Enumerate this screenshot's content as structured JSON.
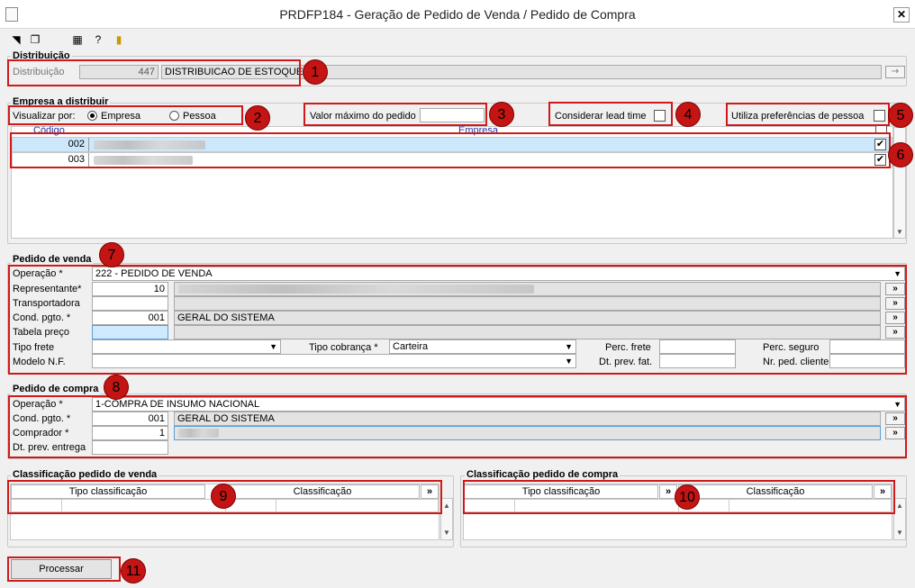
{
  "window": {
    "title": "PRDFP184 - Geração de Pedido de Venda / Pedido de Compra",
    "close": "✕"
  },
  "toolbar": {
    "icons": [
      "exit-icon",
      "copy-icon",
      "calculator-icon",
      "help-icon",
      "door-icon"
    ]
  },
  "distribuicao": {
    "group_label": "Distribuição",
    "field_label": "Distribuição",
    "code": "447",
    "name": "DISTRIBUICAO DE ESTOQUE",
    "button": "⇢"
  },
  "empresa": {
    "group_label": "Empresa a distribuir",
    "visualizar_label": "Visualizar por:",
    "radio_empresa": "Empresa",
    "radio_pessoa": "Pessoa",
    "valor_maximo_label": "Valor máximo do pedido",
    "valor_maximo_value": "",
    "lead_time_label": "Considerar lead time",
    "preferencias_label": "Utiliza preferências de pessoa",
    "columns": {
      "codigo": "Código",
      "empresa": "Empresa"
    },
    "rows": [
      {
        "codigo": "002",
        "empresa": "",
        "checked": "✔"
      },
      {
        "codigo": "003",
        "empresa": "",
        "checked": "✔"
      }
    ]
  },
  "pedido_venda": {
    "group_label": "Pedido de venda",
    "operacao_label": "Operação *",
    "operacao_value": "222 - PEDIDO DE VENDA",
    "representante_label": "Representante*",
    "representante_code": "10",
    "transportadora_label": "Transportadora",
    "cond_pgto_label": "Cond. pgto. *",
    "cond_pgto_code": "001",
    "cond_pgto_name": "GERAL DO SISTEMA",
    "tabela_preco_label": "Tabela preço",
    "tipo_frete_label": "Tipo frete",
    "tipo_cobranca_label": "Tipo cobrança *",
    "tipo_cobranca_value": "Carteira",
    "perc_frete_label": "Perc. frete",
    "perc_seguro_label": "Perc. seguro",
    "modelo_nf_label": "Modelo N.F.",
    "dt_prev_fat_label": "Dt. prev. fat.",
    "nr_ped_cliente_label": "Nr. ped. cliente",
    "lookup": "»"
  },
  "pedido_compra": {
    "group_label": "Pedido de compra",
    "operacao_label": "Operação *",
    "operacao_value": "1-COMPRA DE INSUMO NACIONAL",
    "cond_pgto_label": "Cond. pgto. *",
    "cond_pgto_code": "001",
    "cond_pgto_name": "GERAL DO SISTEMA",
    "comprador_label": "Comprador *",
    "comprador_code": "1",
    "dt_prev_entrega_label": "Dt. prev. entrega"
  },
  "class_venda": {
    "group_label": "Classificação pedido de venda",
    "col1": "Tipo classificação",
    "col2": "Classificação",
    "btn": "»"
  },
  "class_compra": {
    "group_label": "Classificação pedido de compra",
    "col1": "Tipo classificação",
    "col2": "Classificação",
    "btn": "»"
  },
  "actions": {
    "processar": "Processar"
  },
  "callouts": [
    "1",
    "2",
    "3",
    "4",
    "5",
    "6",
    "7",
    "8",
    "9",
    "10",
    "11"
  ],
  "colors": {
    "highlight": "#d01a1a",
    "badge": "#c41414",
    "row_selected": "#cde8fb"
  }
}
